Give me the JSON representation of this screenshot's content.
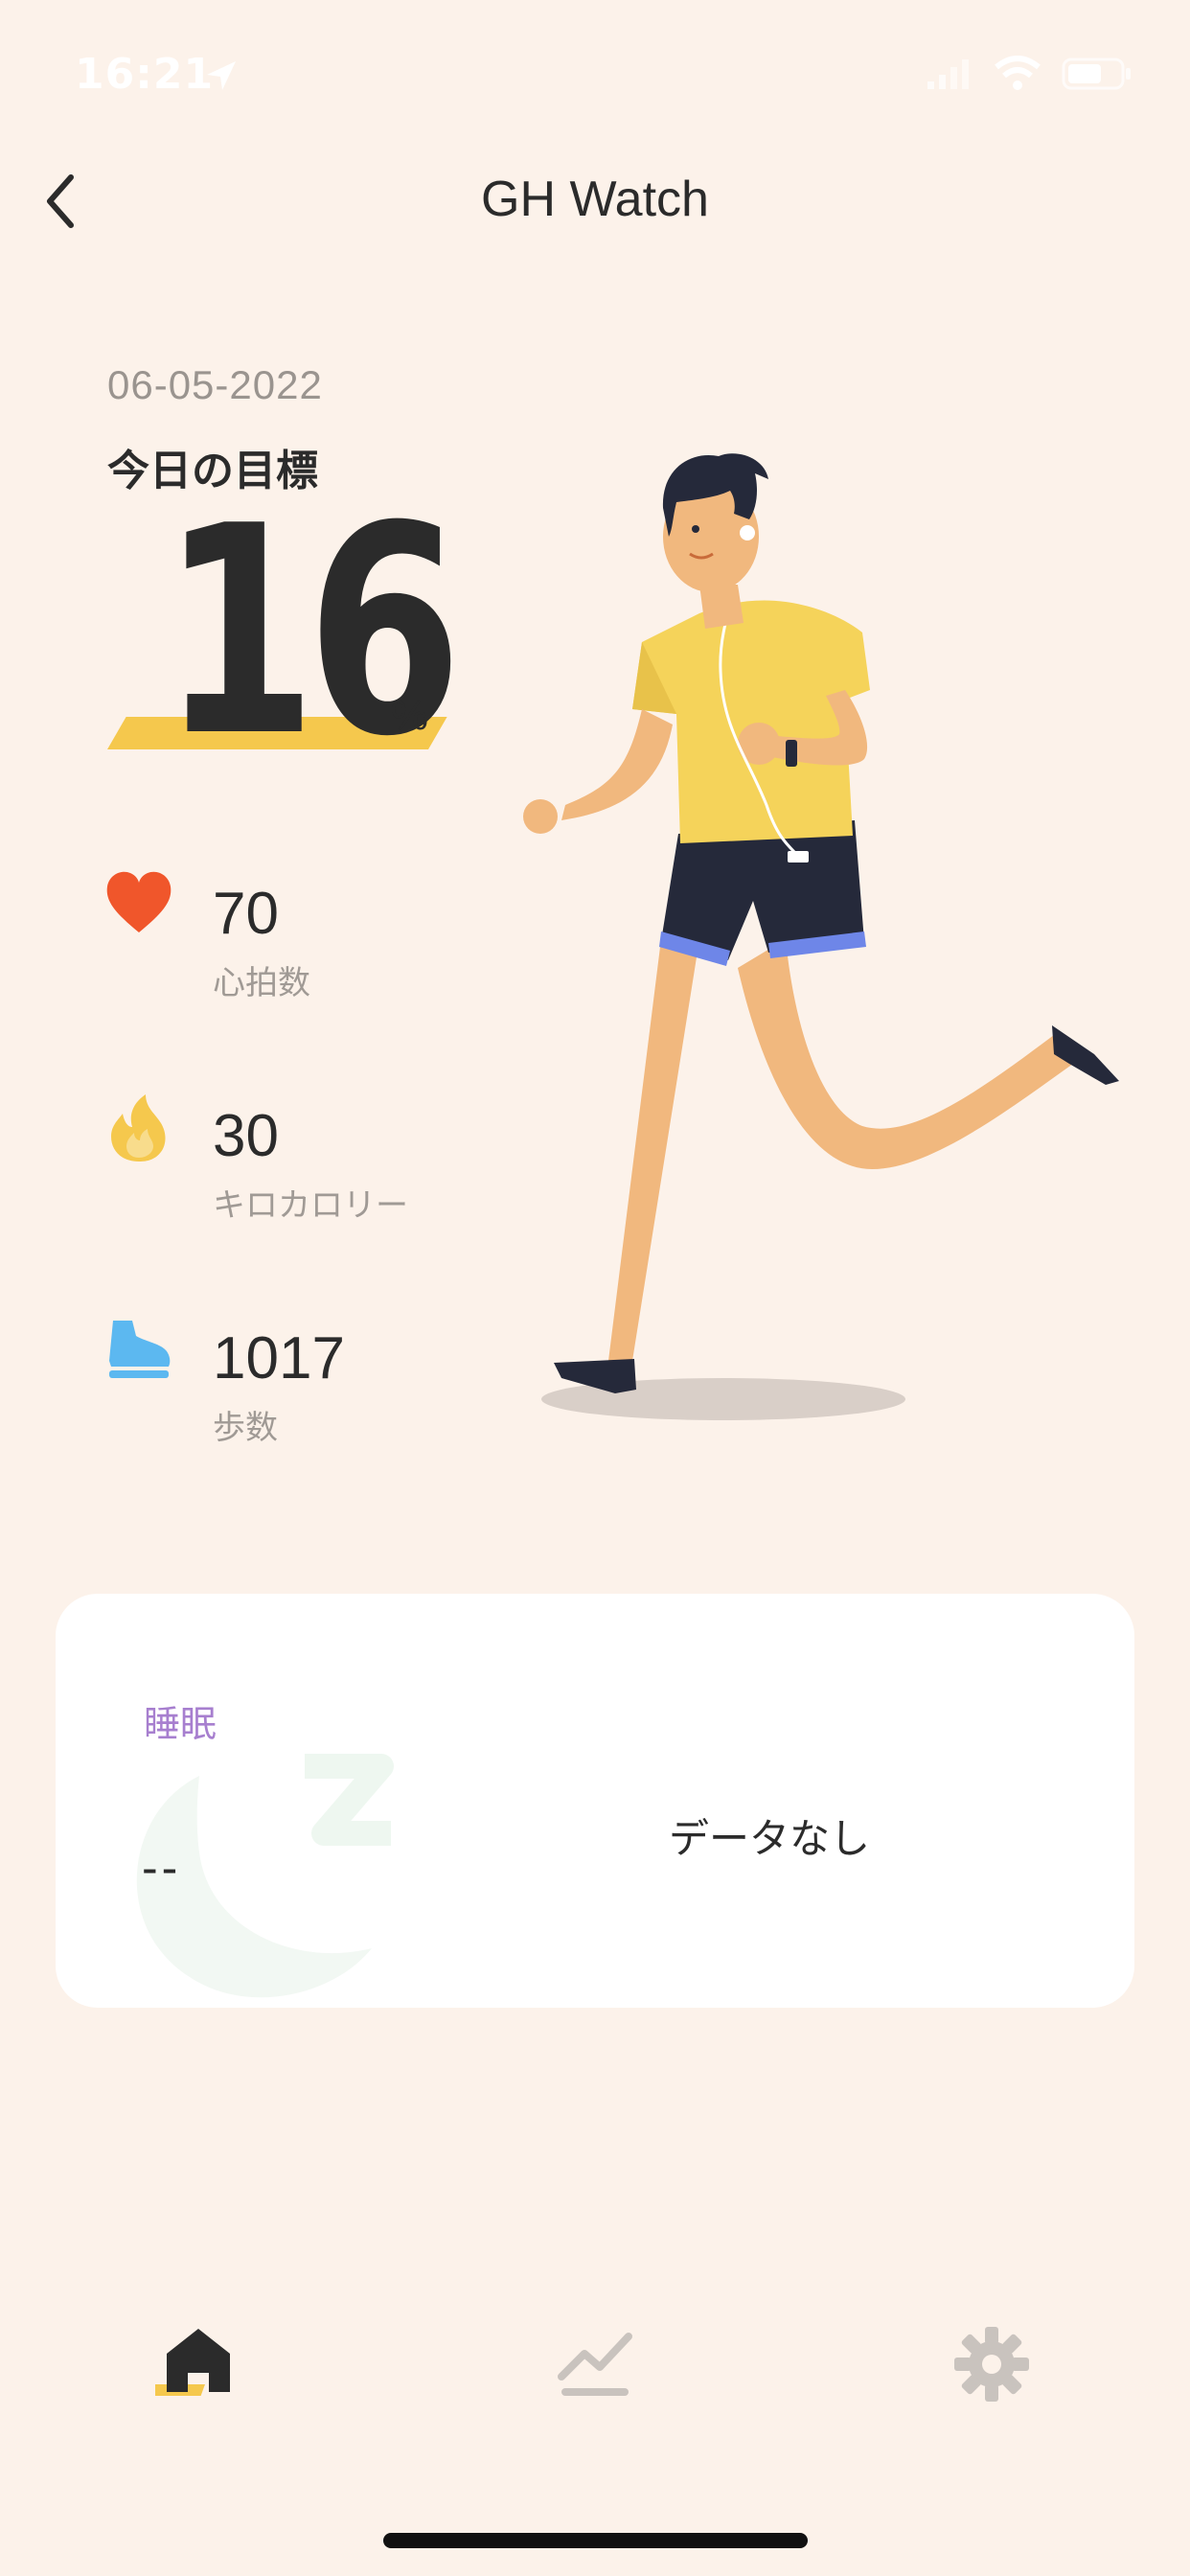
{
  "status_bar": {
    "time": "16:21",
    "icons": [
      "location-arrow-icon",
      "signal-icon",
      "wifi-icon",
      "battery-icon"
    ]
  },
  "header": {
    "title": "GH Watch",
    "back_icon": "chevron-left-icon"
  },
  "goal": {
    "date": "06-05-2022",
    "label": "今日の目標",
    "percent": "16",
    "percent_sign": "%",
    "accent_color": "#f5c84d"
  },
  "metrics": [
    {
      "icon": "heart-icon",
      "value": "70",
      "label": "心拍数",
      "color": "#f0562b"
    },
    {
      "icon": "flame-icon",
      "value": "30",
      "label": "キロカロリー",
      "color": "#f5c84d"
    },
    {
      "icon": "shoe-icon",
      "value": "1017",
      "label": "歩数",
      "color": "#5cb8f0"
    }
  ],
  "sleep": {
    "label": "睡眠",
    "value": "--",
    "no_data": "データなし",
    "label_color": "#a77fcf"
  },
  "tab_bar": {
    "tabs": [
      {
        "icon": "home-icon",
        "active": true
      },
      {
        "icon": "chart-icon",
        "active": false
      },
      {
        "icon": "gear-icon",
        "active": false
      }
    ]
  }
}
